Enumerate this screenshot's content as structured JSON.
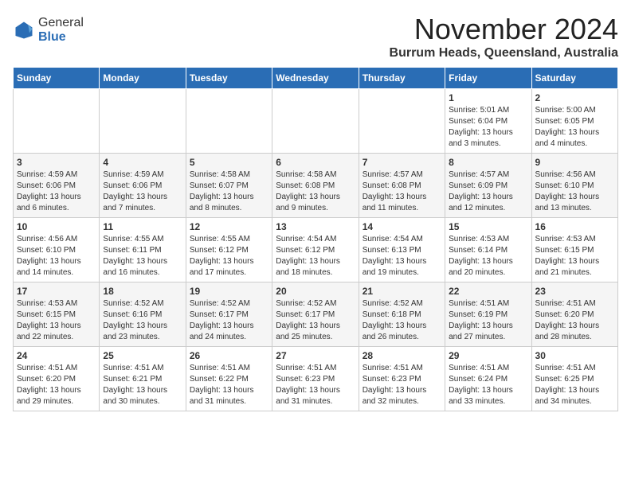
{
  "logo": {
    "general": "General",
    "blue": "Blue"
  },
  "title": "November 2024",
  "location": "Burrum Heads, Queensland, Australia",
  "headers": [
    "Sunday",
    "Monday",
    "Tuesday",
    "Wednesday",
    "Thursday",
    "Friday",
    "Saturday"
  ],
  "weeks": [
    [
      {
        "day": "",
        "info": ""
      },
      {
        "day": "",
        "info": ""
      },
      {
        "day": "",
        "info": ""
      },
      {
        "day": "",
        "info": ""
      },
      {
        "day": "",
        "info": ""
      },
      {
        "day": "1",
        "info": "Sunrise: 5:01 AM\nSunset: 6:04 PM\nDaylight: 13 hours\nand 3 minutes."
      },
      {
        "day": "2",
        "info": "Sunrise: 5:00 AM\nSunset: 6:05 PM\nDaylight: 13 hours\nand 4 minutes."
      }
    ],
    [
      {
        "day": "3",
        "info": "Sunrise: 4:59 AM\nSunset: 6:06 PM\nDaylight: 13 hours\nand 6 minutes."
      },
      {
        "day": "4",
        "info": "Sunrise: 4:59 AM\nSunset: 6:06 PM\nDaylight: 13 hours\nand 7 minutes."
      },
      {
        "day": "5",
        "info": "Sunrise: 4:58 AM\nSunset: 6:07 PM\nDaylight: 13 hours\nand 8 minutes."
      },
      {
        "day": "6",
        "info": "Sunrise: 4:58 AM\nSunset: 6:08 PM\nDaylight: 13 hours\nand 9 minutes."
      },
      {
        "day": "7",
        "info": "Sunrise: 4:57 AM\nSunset: 6:08 PM\nDaylight: 13 hours\nand 11 minutes."
      },
      {
        "day": "8",
        "info": "Sunrise: 4:57 AM\nSunset: 6:09 PM\nDaylight: 13 hours\nand 12 minutes."
      },
      {
        "day": "9",
        "info": "Sunrise: 4:56 AM\nSunset: 6:10 PM\nDaylight: 13 hours\nand 13 minutes."
      }
    ],
    [
      {
        "day": "10",
        "info": "Sunrise: 4:56 AM\nSunset: 6:10 PM\nDaylight: 13 hours\nand 14 minutes."
      },
      {
        "day": "11",
        "info": "Sunrise: 4:55 AM\nSunset: 6:11 PM\nDaylight: 13 hours\nand 16 minutes."
      },
      {
        "day": "12",
        "info": "Sunrise: 4:55 AM\nSunset: 6:12 PM\nDaylight: 13 hours\nand 17 minutes."
      },
      {
        "day": "13",
        "info": "Sunrise: 4:54 AM\nSunset: 6:12 PM\nDaylight: 13 hours\nand 18 minutes."
      },
      {
        "day": "14",
        "info": "Sunrise: 4:54 AM\nSunset: 6:13 PM\nDaylight: 13 hours\nand 19 minutes."
      },
      {
        "day": "15",
        "info": "Sunrise: 4:53 AM\nSunset: 6:14 PM\nDaylight: 13 hours\nand 20 minutes."
      },
      {
        "day": "16",
        "info": "Sunrise: 4:53 AM\nSunset: 6:15 PM\nDaylight: 13 hours\nand 21 minutes."
      }
    ],
    [
      {
        "day": "17",
        "info": "Sunrise: 4:53 AM\nSunset: 6:15 PM\nDaylight: 13 hours\nand 22 minutes."
      },
      {
        "day": "18",
        "info": "Sunrise: 4:52 AM\nSunset: 6:16 PM\nDaylight: 13 hours\nand 23 minutes."
      },
      {
        "day": "19",
        "info": "Sunrise: 4:52 AM\nSunset: 6:17 PM\nDaylight: 13 hours\nand 24 minutes."
      },
      {
        "day": "20",
        "info": "Sunrise: 4:52 AM\nSunset: 6:17 PM\nDaylight: 13 hours\nand 25 minutes."
      },
      {
        "day": "21",
        "info": "Sunrise: 4:52 AM\nSunset: 6:18 PM\nDaylight: 13 hours\nand 26 minutes."
      },
      {
        "day": "22",
        "info": "Sunrise: 4:51 AM\nSunset: 6:19 PM\nDaylight: 13 hours\nand 27 minutes."
      },
      {
        "day": "23",
        "info": "Sunrise: 4:51 AM\nSunset: 6:20 PM\nDaylight: 13 hours\nand 28 minutes."
      }
    ],
    [
      {
        "day": "24",
        "info": "Sunrise: 4:51 AM\nSunset: 6:20 PM\nDaylight: 13 hours\nand 29 minutes."
      },
      {
        "day": "25",
        "info": "Sunrise: 4:51 AM\nSunset: 6:21 PM\nDaylight: 13 hours\nand 30 minutes."
      },
      {
        "day": "26",
        "info": "Sunrise: 4:51 AM\nSunset: 6:22 PM\nDaylight: 13 hours\nand 31 minutes."
      },
      {
        "day": "27",
        "info": "Sunrise: 4:51 AM\nSunset: 6:23 PM\nDaylight: 13 hours\nand 31 minutes."
      },
      {
        "day": "28",
        "info": "Sunrise: 4:51 AM\nSunset: 6:23 PM\nDaylight: 13 hours\nand 32 minutes."
      },
      {
        "day": "29",
        "info": "Sunrise: 4:51 AM\nSunset: 6:24 PM\nDaylight: 13 hours\nand 33 minutes."
      },
      {
        "day": "30",
        "info": "Sunrise: 4:51 AM\nSunset: 6:25 PM\nDaylight: 13 hours\nand 34 minutes."
      }
    ]
  ]
}
